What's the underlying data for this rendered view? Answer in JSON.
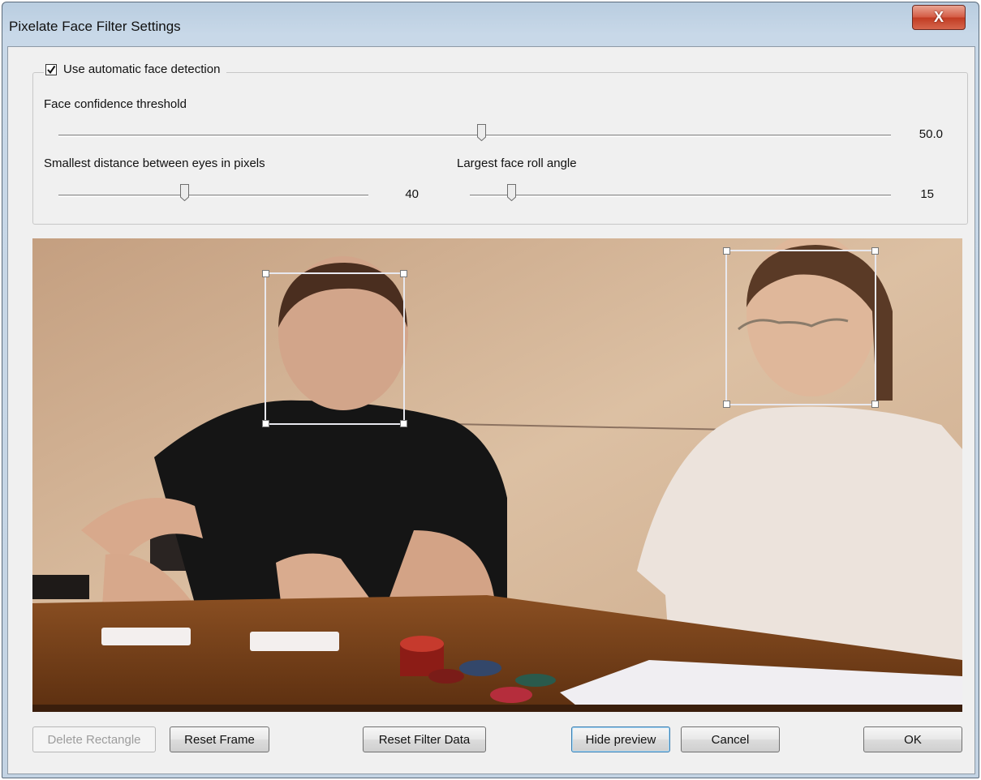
{
  "window": {
    "title": "Pixelate Face Filter Settings",
    "close_glyph": "X"
  },
  "detection": {
    "checkbox_label": "Use automatic face detection",
    "checked": true,
    "confidence": {
      "label": "Face confidence threshold",
      "value_text": "50.0",
      "level": 0.5
    },
    "eye_distance": {
      "label": "Smallest distance between eyes in pixels",
      "value_text": "40",
      "level": 0.4
    },
    "roll_angle": {
      "label": "Largest face roll angle",
      "value_text": "15",
      "level": 0.1
    }
  },
  "preview": {
    "detected_faces": 2,
    "face_box_color": "#e8e8ee"
  },
  "buttons": {
    "delete_rectangle": "Delete Rectangle",
    "reset_frame": "Reset Frame",
    "reset_filter_data": "Reset Filter Data",
    "hide_preview": "Hide preview",
    "cancel": "Cancel",
    "ok": "OK"
  },
  "colors": {
    "title_bar": "#c3d3e3",
    "close_button": "#c94a30",
    "dialog_bg": "#f0f0f0"
  }
}
